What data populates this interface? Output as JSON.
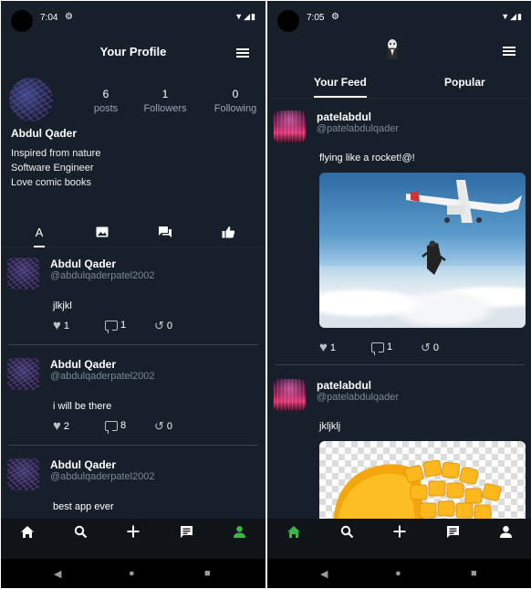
{
  "left_screen": {
    "status": {
      "time": "7:04"
    },
    "header": {
      "title": "Your Profile"
    },
    "profile": {
      "stats": [
        {
          "value": "6",
          "label": "posts"
        },
        {
          "value": "1",
          "label": "Followers"
        },
        {
          "value": "0",
          "label": "Following"
        }
      ],
      "name": "Abdul Qader",
      "bio": [
        "Inspired from nature",
        "Software Engineer",
        "Love comic books"
      ]
    },
    "tabs": [
      {
        "icon": "text-icon",
        "active": true
      },
      {
        "icon": "image-icon",
        "active": false
      },
      {
        "icon": "chat-icon",
        "active": false
      },
      {
        "icon": "thumbs-up-icon",
        "active": false
      }
    ],
    "posts": [
      {
        "name": "Abdul Qader",
        "handle": "@abdulqaderpatel2002",
        "text": "jlkjkl",
        "likes": "1",
        "comments": "1",
        "reposts": "0"
      },
      {
        "name": "Abdul Qader",
        "handle": "@abdulqaderpatel2002",
        "text": "i will be there",
        "likes": "2",
        "comments": "8",
        "reposts": "0"
      },
      {
        "name": "Abdul Qader",
        "handle": "@abdulqaderpatel2002",
        "text": "best app ever"
      }
    ],
    "nav": [
      "home-icon",
      "search-icon",
      "add-icon",
      "messages-icon",
      "profile-icon"
    ],
    "nav_active": "profile-icon"
  },
  "right_screen": {
    "status": {
      "time": "7:05"
    },
    "feed_tabs": [
      {
        "label": "Your Feed",
        "active": true
      },
      {
        "label": "Popular",
        "active": false
      }
    ],
    "posts": [
      {
        "name": "patelabdul",
        "handle": "@patelabdulqader",
        "text": "flying like a rocket!@!",
        "image": "skydiver-plane",
        "likes": "1",
        "comments": "1",
        "reposts": "0"
      },
      {
        "name": "patelabdul",
        "handle": "@patelabdulqader",
        "text": "jkljklj",
        "image": "mango"
      }
    ],
    "nav": [
      "home-icon",
      "search-icon",
      "add-icon",
      "messages-icon",
      "profile-icon"
    ],
    "nav_active": "home-icon"
  },
  "colors": {
    "background": "#17202a",
    "accent_green": "#3bb54a",
    "muted_text": "#7a8795",
    "navbar": "#0f1419"
  }
}
